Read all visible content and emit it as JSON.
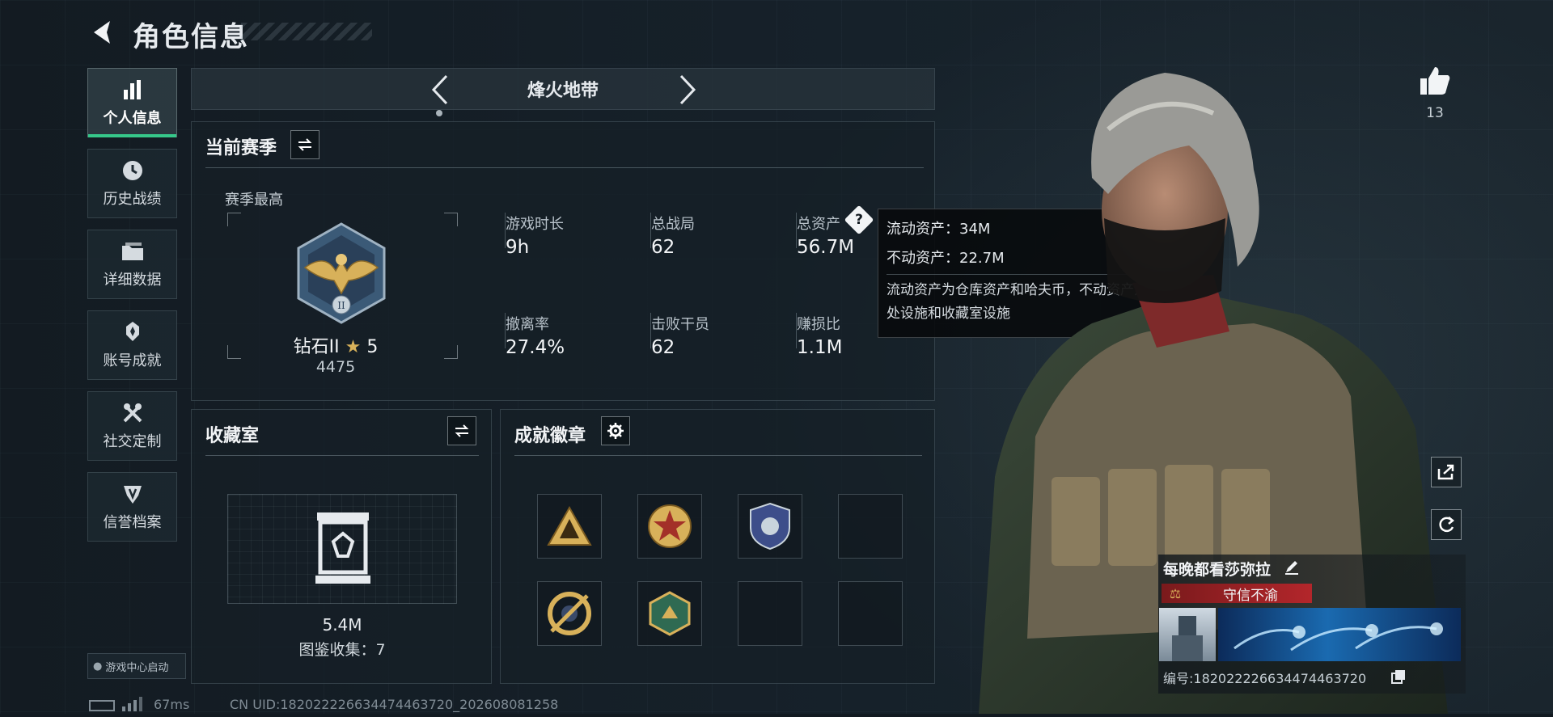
{
  "header": {
    "title": "角色信息"
  },
  "nav": [
    {
      "label": "个人信息",
      "icon": "bar-chart-icon",
      "active": true
    },
    {
      "label": "历史战绩",
      "icon": "clock-icon"
    },
    {
      "label": "详细数据",
      "icon": "folder-icon"
    },
    {
      "label": "账号成就",
      "icon": "medal-icon"
    },
    {
      "label": "社交定制",
      "icon": "tools-icon"
    },
    {
      "label": "信誉档案",
      "icon": "shield-icon"
    }
  ],
  "game_center": "游戏中心启动",
  "mode": {
    "title": "烽火地带"
  },
  "season": {
    "title": "当前赛季",
    "best_label": "赛季最高",
    "rank": "钻石II",
    "stars": "5",
    "score": "4475",
    "stats": [
      {
        "label": "游戏时长",
        "value": "9h"
      },
      {
        "label": "总战局",
        "value": "62"
      },
      {
        "label": "总资产",
        "value": "56.7M"
      },
      {
        "label": "撤离率",
        "value": "27.4%"
      },
      {
        "label": "击败干员",
        "value": "62"
      },
      {
        "label": "赚损比",
        "value": "1.1M"
      }
    ]
  },
  "tooltip": {
    "liquid": "流动资产：34M",
    "fixed": "不动资产：22.7M",
    "desc": "流动资产为仓库资产和哈夫币，不动资产为特勤处设施和收藏室设施"
  },
  "collection": {
    "title": "收藏室",
    "value": "5.4M",
    "count": "图鉴收集：7"
  },
  "badges": {
    "title": "成就徽章"
  },
  "likes": {
    "count": "13"
  },
  "player": {
    "name": "每晚都看莎弥拉",
    "title": "守信不渝",
    "id": "编号:1820222266344744637‌20"
  },
  "footer": {
    "ping": "67ms",
    "uid": "CN UID:18202222663447446372​0_202608081258"
  },
  "colors": {
    "accent": "#36c88a",
    "title_badge": "#b3262b",
    "gold": "#d8b15a"
  }
}
